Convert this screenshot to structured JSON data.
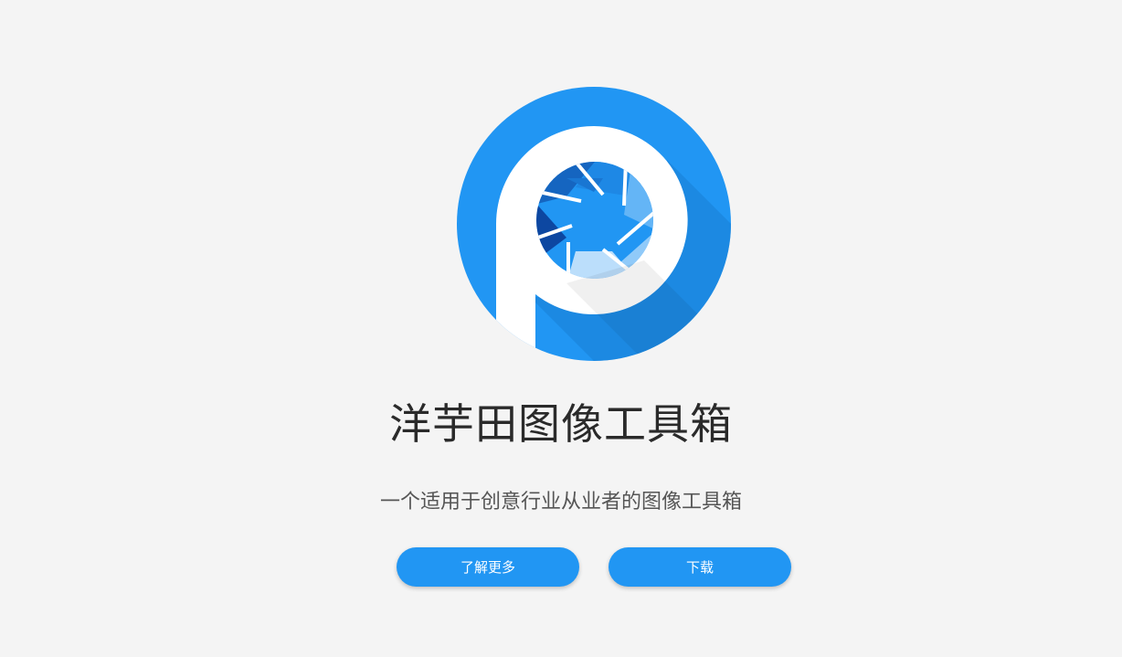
{
  "app": {
    "title": "洋芋田图像工具箱",
    "subtitle": "一个适用于创意行业从业者的图像工具箱"
  },
  "logo": {
    "icon": "aperture-p-logo-icon"
  },
  "actions": {
    "learn_more_label": "了解更多",
    "download_label": "下载"
  },
  "colors": {
    "background": "#f4f4f4",
    "brand_blue": "#2196f3",
    "brand_blue_dark": "#1565c0",
    "brand_blue_light": "#90caf9",
    "text_primary": "#2a2a2a",
    "text_secondary": "#555555"
  }
}
